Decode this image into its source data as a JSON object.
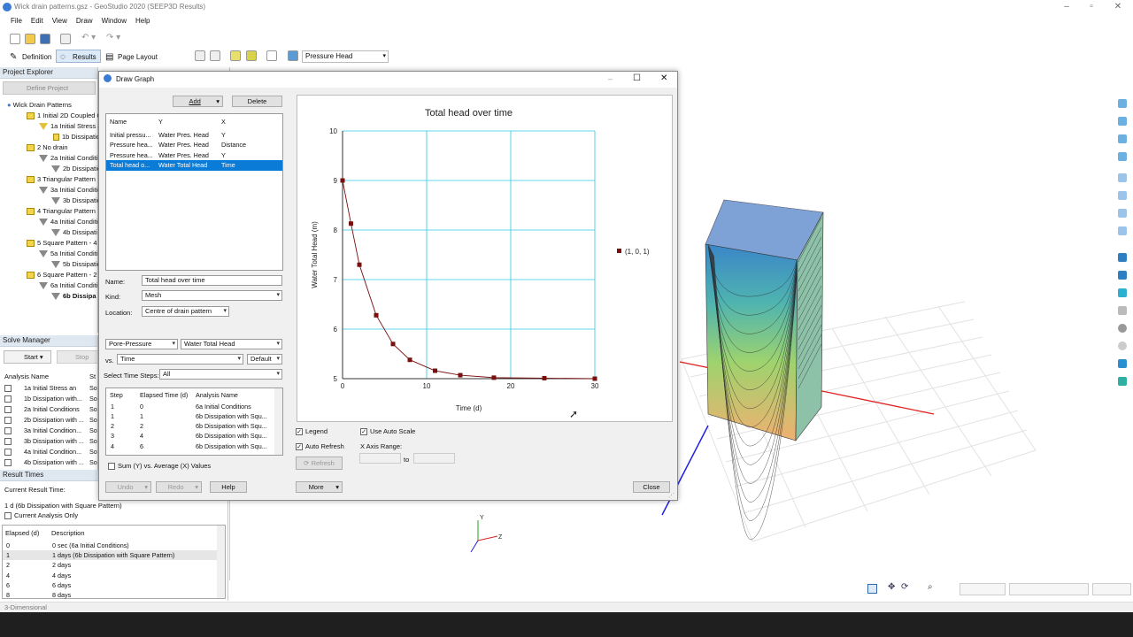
{
  "window": {
    "title": "Wick drain patterns.gsz - GeoStudio 2020 (SEEP3D Results)"
  },
  "menu": [
    "File",
    "Edit",
    "View",
    "Draw",
    "Window",
    "Help"
  ],
  "modes": {
    "definition": "Definition",
    "results": "Results",
    "page_layout": "Page Layout",
    "result_type": "Pressure Head"
  },
  "project_explorer": {
    "title": "Project Explorer",
    "define_btn": "Define Project",
    "root": "Wick Drain Patterns",
    "items": [
      "1 Initial 2D Coupled C",
      "1a Initial Stress a",
      "1b Dissipatio",
      "2 No drain",
      "2a Initial Conditi",
      "2b Dissipatio",
      "3 Triangular Pattern",
      "3a Initial Conditio",
      "3b Dissipatio",
      "4 Triangular Pattern",
      "4a Initial Conditio",
      "4b Dissipati",
      "5 Square Pattern - 4",
      "5a Initial Conditi",
      "5b Dissipatio",
      "6 Square Pattern - 2",
      "6a Initial Conditi",
      "6b Dissipa"
    ]
  },
  "solve_manager": {
    "title": "Solve Manager",
    "start": "Start",
    "stop": "Stop",
    "col_analysis": "Analysis Name",
    "col_status": "St",
    "rows": [
      {
        "name": "1a Initial Stress an",
        "status": "So"
      },
      {
        "name": "1b Dissipation with...",
        "status": "So"
      },
      {
        "name": "2a Initial Conditions",
        "status": "So"
      },
      {
        "name": "2b Dissipation with ...",
        "status": "So"
      },
      {
        "name": "3a Initial Condition...",
        "status": "So"
      },
      {
        "name": "3b Dissipation with ...",
        "status": "So"
      },
      {
        "name": "4a Initial Condition...",
        "status": "So"
      },
      {
        "name": "4b Dissipation with ...",
        "status": "So"
      }
    ]
  },
  "result_times": {
    "title": "Result Times",
    "current_label": "Current Result Time:",
    "current_value": "1 d (6b Dissipation with Square Pattern)",
    "current_only": "Current Analysis Only",
    "col_elapsed": "Elapsed (d)",
    "col_desc": "Description",
    "rows": [
      {
        "e": "0",
        "d": "0 sec (6a Initial Conditions)"
      },
      {
        "e": "1",
        "d": "1 days (6b Dissipation with Square Pattern)"
      },
      {
        "e": "2",
        "d": "2 days"
      },
      {
        "e": "4",
        "d": "4 days"
      },
      {
        "e": "6",
        "d": "6 days"
      },
      {
        "e": "8",
        "d": "8 days"
      }
    ]
  },
  "status_bar": "3-Dimensional",
  "dialog": {
    "title": "Draw Graph",
    "add": "Add",
    "delete": "Delete",
    "graphs_header": {
      "name": "Name",
      "y": "Y",
      "x": "X"
    },
    "graphs": [
      {
        "name": "Initial pressu...",
        "y": "Water Pres. Head",
        "x": "Y"
      },
      {
        "name": "Pressure hea...",
        "y": "Water Pres. Head",
        "x": "Distance"
      },
      {
        "name": "Pressure hea...",
        "y": "Water Pres. Head",
        "x": "Y"
      },
      {
        "name": "Total head o...",
        "y": "Water Total Head",
        "x": "Time"
      }
    ],
    "name_label": "Name:",
    "name_value": "Total head over time",
    "kind_label": "Kind:",
    "kind_value": "Mesh",
    "location_label": "Location:",
    "location_value": "Centre of drain pattern",
    "y_category": "Pore-Pressure",
    "y_param": "Water Total Head",
    "vs_label": "vs.",
    "x_param": "Time",
    "x_option": "Default",
    "steps_label": "Select Time Steps:",
    "steps_value": "All",
    "steps_header": {
      "step": "Step",
      "elapsed": "Elapsed Time (d)",
      "analysis": "Analysis Name"
    },
    "steps": [
      {
        "s": "1",
        "t": "0",
        "a": "6a Initial Conditions"
      },
      {
        "s": "1",
        "t": "1",
        "a": "6b Dissipation with Squ..."
      },
      {
        "s": "2",
        "t": "2",
        "a": "6b Dissipation with Squ..."
      },
      {
        "s": "3",
        "t": "4",
        "a": "6b Dissipation with Squ..."
      },
      {
        "s": "4",
        "t": "6",
        "a": "6b Dissipation with Squ..."
      }
    ],
    "sum_label": "Sum (Y) vs. Average (X) Values",
    "undo": "Undo",
    "redo": "Redo",
    "help": "Help",
    "legend": "Legend",
    "auto_scale": "Use Auto Scale",
    "auto_refresh": "Auto Refresh",
    "x_axis_range": "X Axis Range:",
    "refresh": "Refresh",
    "to": "to",
    "more": "More",
    "close": "Close"
  },
  "chart_data": {
    "type": "line",
    "title": "Total head over time",
    "xlabel": "Time (d)",
    "ylabel": "Water Total Head (m)",
    "xlim": [
      0,
      30
    ],
    "ylim": [
      5,
      10
    ],
    "xticks": [
      "0",
      "10",
      "20",
      "30"
    ],
    "yticks": [
      "5",
      "6",
      "7",
      "8",
      "9",
      "10"
    ],
    "grid": true,
    "legend_position": "right",
    "series": [
      {
        "name": "(1, 0, 1)",
        "color": "#7a0f0f",
        "x": [
          0,
          1,
          2,
          4,
          6,
          8,
          11,
          14,
          18,
          24,
          30
        ],
        "y": [
          9.0,
          8.13,
          7.3,
          6.28,
          5.7,
          5.38,
          5.16,
          5.07,
          5.02,
          5.01,
          5.0
        ]
      }
    ]
  }
}
